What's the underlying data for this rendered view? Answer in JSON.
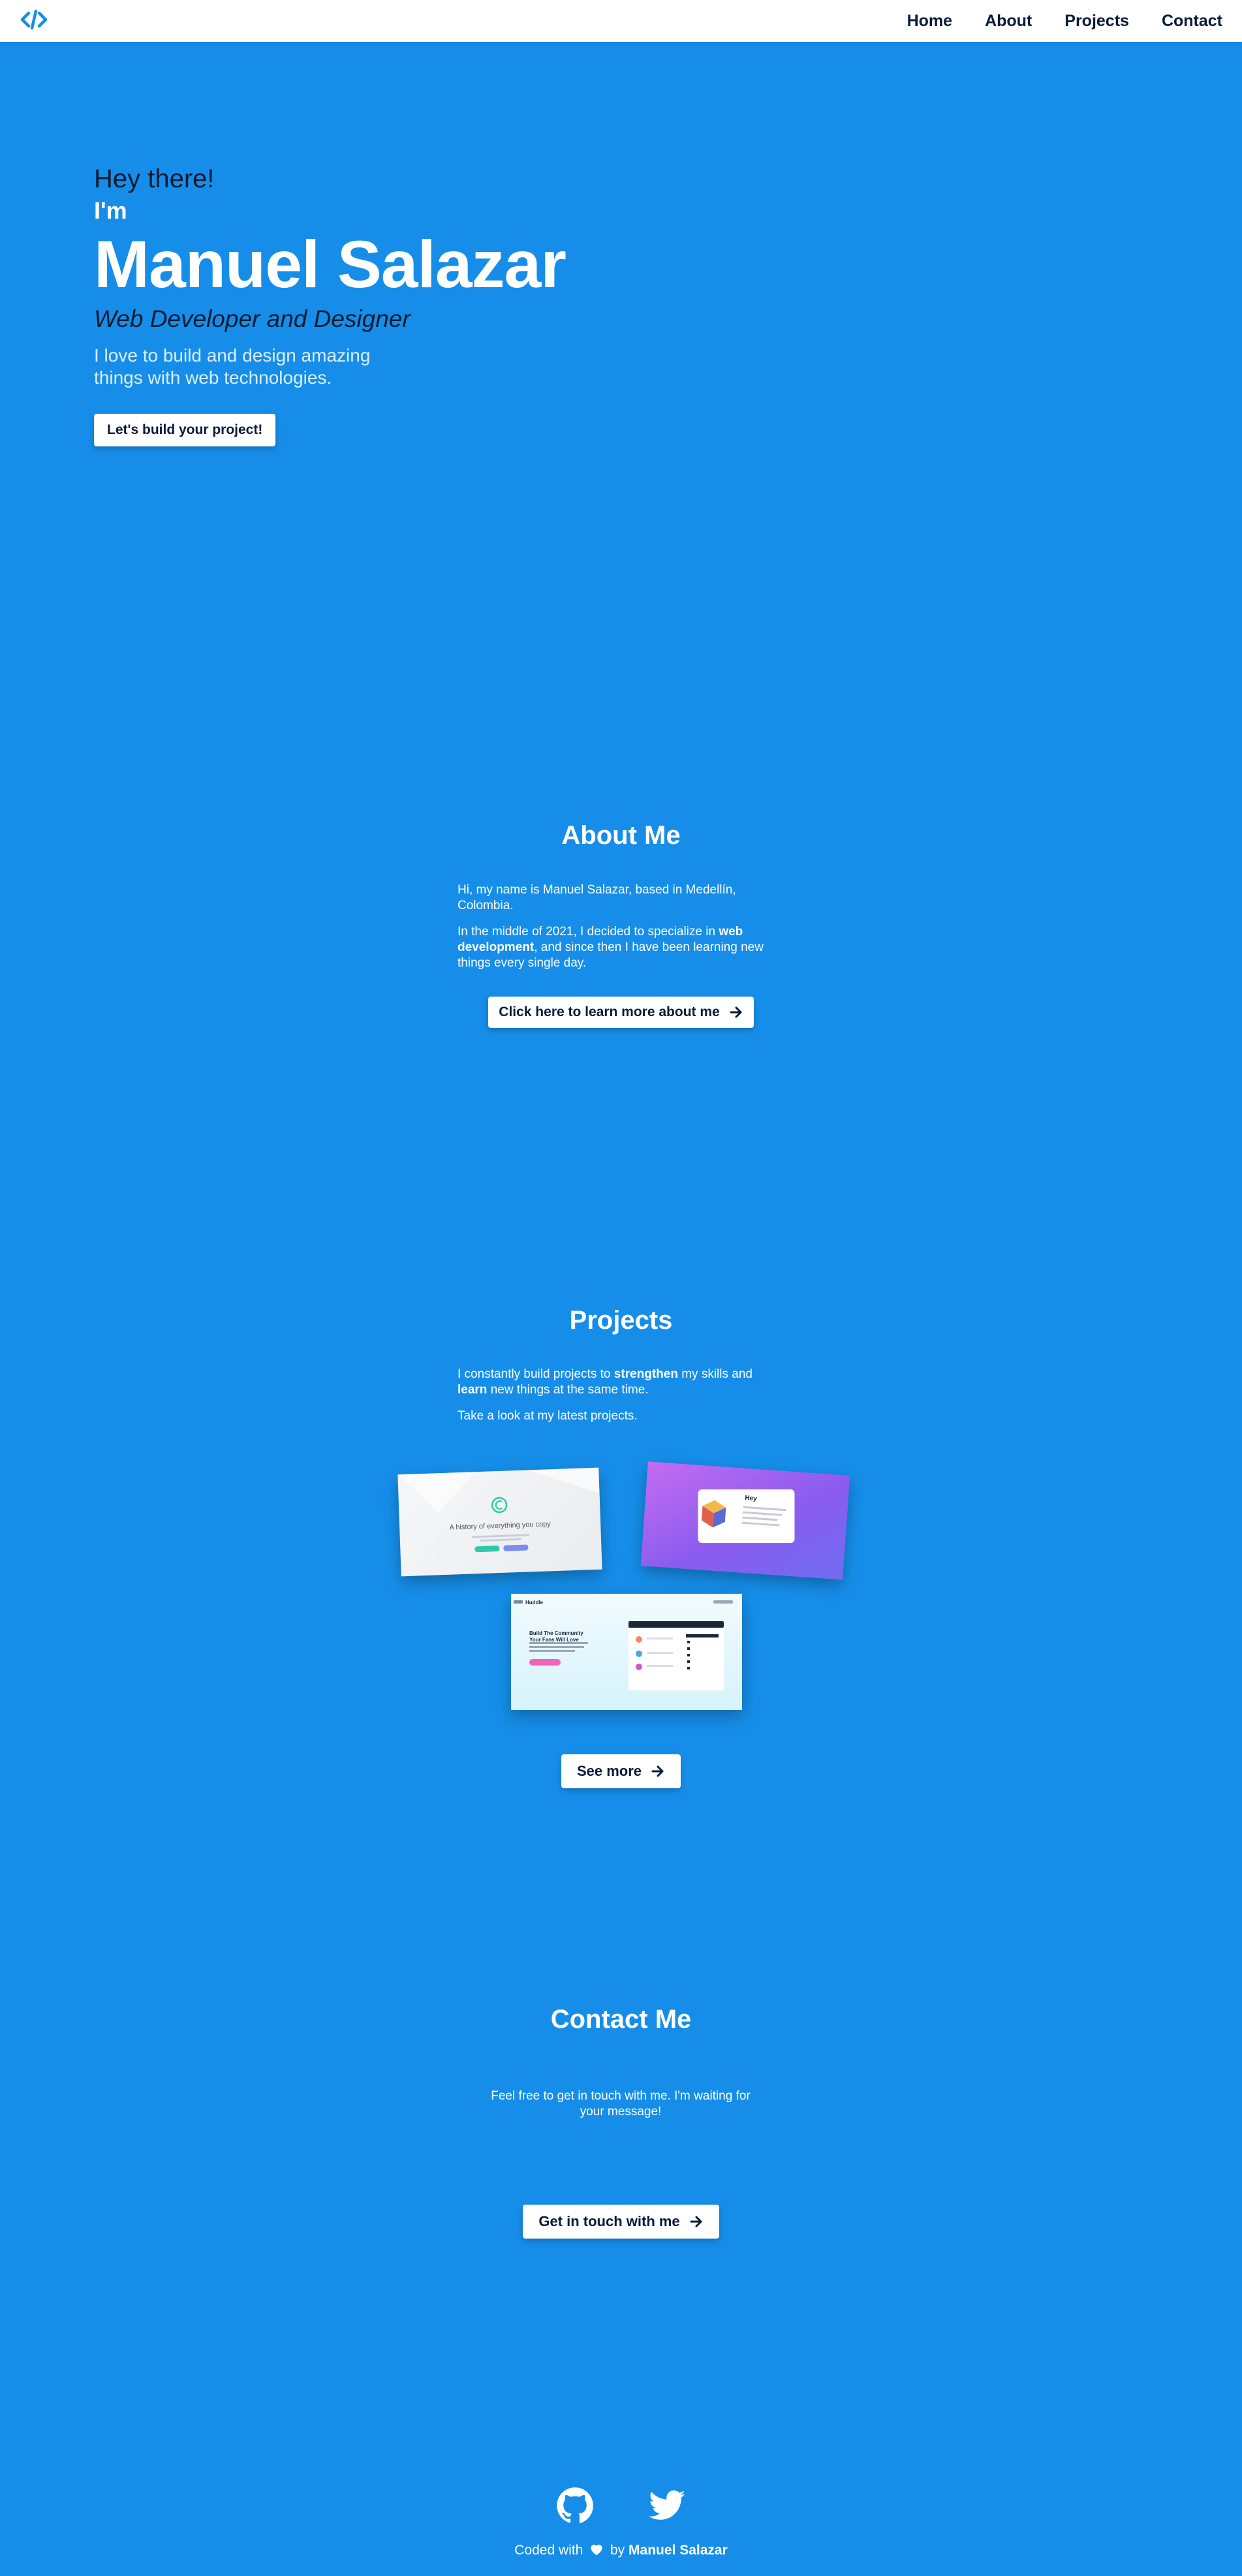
{
  "colors": {
    "background": "#168ee9",
    "nav_background": "#ffffff",
    "nav_text": "#0a1a3a",
    "accent_dark": "#0d1b33",
    "white": "#ffffff"
  },
  "nav": {
    "logo_icon": "code-brackets-icon",
    "links": [
      "Home",
      "About",
      "Projects",
      "Contact"
    ]
  },
  "hero": {
    "greeting": "Hey there!",
    "im": "I'm",
    "name": "Manuel Salazar",
    "role": "Web Developer and Designer",
    "description": "I love to build and design amazing things with web technologies.",
    "button_label": "Let's build your project!"
  },
  "about": {
    "title": "About Me",
    "p1": "Hi, my name is Manuel Salazar, based in Medellín, Colombia.",
    "p2_pre": "In the middle of 2021, I decided to specialize in ",
    "p2_bold": "web development",
    "p2_post": ", and since then I have been learning new things every single day.",
    "button_label": "Click here to learn more about me",
    "button_icon": "arrow-right-icon"
  },
  "projects": {
    "title": "Projects",
    "p1_a": "I constantly build projects to ",
    "p1_b": "strengthen",
    "p1_c": " my skills and ",
    "p1_d": "learn",
    "p1_e": " new things at the same time.",
    "p2": "Take a look at my latest projects.",
    "card1_text": "A history of everything you copy",
    "card2_text": "Hey",
    "card3_brand": "Huddle",
    "card3_heading": "Build The Community Your Fans Will Love",
    "see_more_label": "See more",
    "see_more_icon": "arrow-right-icon"
  },
  "contact": {
    "title": "Contact Me",
    "text": "Feel free to get in touch with me. I'm waiting for your message!",
    "button_label": "Get in touch with me",
    "button_icon": "arrow-right-icon"
  },
  "footer": {
    "icons": [
      "github-icon",
      "twitter-icon"
    ],
    "coded_with": "Coded with",
    "by": "by",
    "author": "Manuel Salazar"
  }
}
